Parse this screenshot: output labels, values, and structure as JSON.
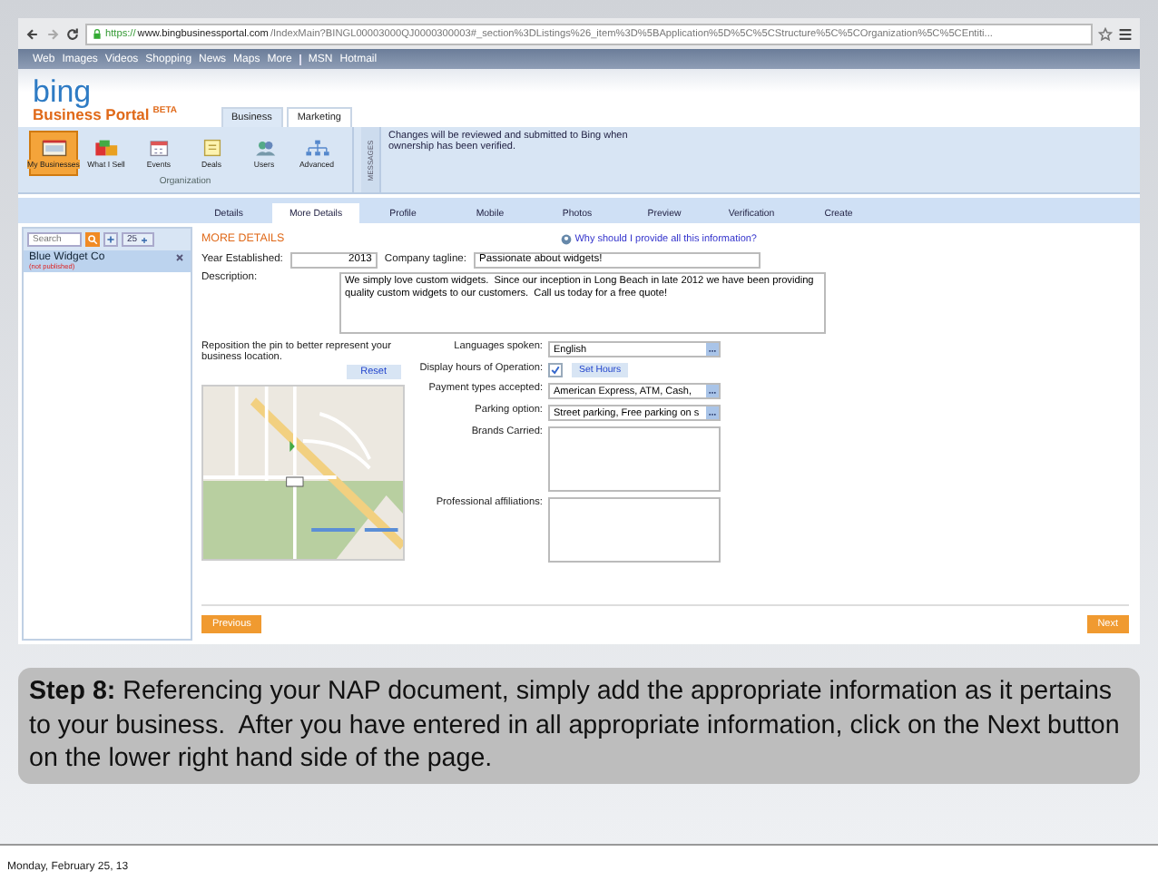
{
  "browser": {
    "url_scheme": "https://",
    "url_host": "www.bingbusinessportal.com",
    "url_path": "/IndexMain?BINGL00003000QJ0000300003#_section%3DListings%26_item%3D%5BApplication%5D%5C%5CStructure%5C%5COrganization%5C%5CEntiti..."
  },
  "nav_groups": [
    [
      {
        "label": "Web"
      },
      {
        "label": "Images"
      },
      {
        "label": "Videos"
      },
      {
        "label": "Shopping"
      },
      {
        "label": "News"
      },
      {
        "label": "Maps"
      },
      {
        "label": "More"
      }
    ],
    [
      {
        "label": "MSN"
      },
      {
        "label": "Hotmail"
      }
    ]
  ],
  "header": {
    "logo": "bing",
    "portal_title": "Business Portal",
    "badge": "BETA"
  },
  "top_tabs": [
    {
      "label": "Business",
      "selected": true
    },
    {
      "label": "Marketing",
      "selected": false
    }
  ],
  "ribbon": {
    "group_label": "Organization",
    "items": [
      {
        "label": "My Businesses",
        "selected": true
      },
      {
        "label": "What I Sell",
        "selected": false
      },
      {
        "label": "Events",
        "selected": false
      },
      {
        "label": "Deals",
        "selected": false
      },
      {
        "label": "Users",
        "selected": false
      },
      {
        "label": "Advanced",
        "selected": false
      }
    ]
  },
  "messages": {
    "title": "MESSAGES",
    "text": "Changes will be reviewed and submitted to Bing when ownership has been verified."
  },
  "page_tabs": [
    {
      "label": "Details",
      "selected": false
    },
    {
      "label": "More Details",
      "selected": true
    },
    {
      "label": "Profile",
      "selected": false
    },
    {
      "label": "Mobile",
      "selected": false
    },
    {
      "label": "Photos",
      "selected": false
    },
    {
      "label": "Preview",
      "selected": false
    },
    {
      "label": "Verification",
      "selected": false
    },
    {
      "label": "Create",
      "selected": false
    }
  ],
  "sidebar": {
    "search_placeholder": "Search",
    "page_size": "25",
    "items": [
      {
        "name": "Blue Widget Co",
        "status": "(not published)",
        "selected": true
      }
    ]
  },
  "form": {
    "title": "MORE DETAILS",
    "help_link": "Why should I provide all this information?",
    "year_label": "Year Established:",
    "year_value": "2013",
    "tagline_label": "Company tagline:",
    "tagline_value": "Passionate about widgets!",
    "description_label": "Description:",
    "description_value": "We simply love custom widgets.  Since our inception in Long Beach in late 2012 we have been providing quality custom widgets to our customers.  Call us today for a free quote!",
    "map_hint": "Reposition the pin to better represent your business location.",
    "reset_button": "Reset",
    "fields": [
      {
        "kind": "select",
        "label": "Languages spoken:",
        "value": "English"
      },
      {
        "kind": "checkbox",
        "label": "Display hours of Operation:",
        "checked": true,
        "button": "Set Hours"
      },
      {
        "kind": "select",
        "label": "Payment types accepted:",
        "value": "American Express, ATM, Cash, "
      },
      {
        "kind": "select",
        "label": "Parking option:",
        "value": "Street parking, Free parking on s"
      },
      {
        "kind": "textarea",
        "label": "Brands Carried:"
      },
      {
        "kind": "textarea",
        "label": "Professional affiliations:"
      }
    ]
  },
  "buttons": {
    "previous": "Previous",
    "next": "Next"
  },
  "caption": "**Step 8:** Referencing your NAP document, simply add the appropriate information as it pertains to your business.  After you have entered in all appropriate information, click on the Next button on the lower right hand side of the page.",
  "footer_date": "Monday, February 25, 13"
}
